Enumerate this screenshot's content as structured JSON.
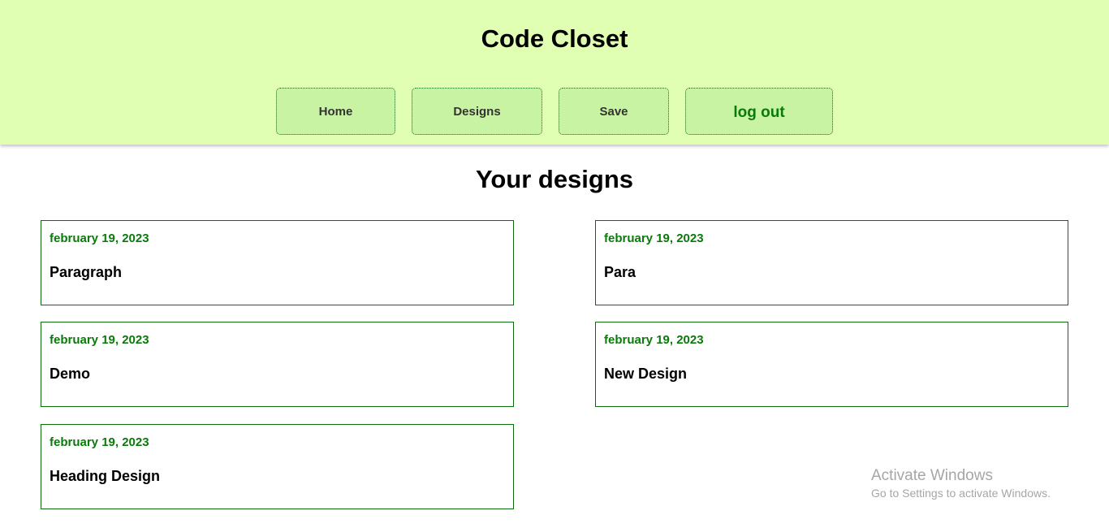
{
  "header": {
    "title": "Code Closet",
    "nav": {
      "home": "Home",
      "designs": "Designs",
      "save": "Save",
      "logout": "log out"
    }
  },
  "main": {
    "title": "Your designs",
    "designs": [
      {
        "date": "february 19, 2023",
        "name": "Paragraph"
      },
      {
        "date": "february 19, 2023",
        "name": "Para"
      },
      {
        "date": "february 19, 2023",
        "name": "Demo"
      },
      {
        "date": "february 19, 2023",
        "name": "New Design"
      },
      {
        "date": "february 19, 2023",
        "name": "Heading Design"
      }
    ]
  },
  "watermark": {
    "title": "Activate Windows",
    "subtitle": "Go to Settings to activate Windows."
  },
  "colors": {
    "header_bg": "#e0ffb3",
    "nav_button_bg": "#c8f3a3",
    "accent_green": "#0a7a0a",
    "card_border": "#0a6b0a"
  }
}
